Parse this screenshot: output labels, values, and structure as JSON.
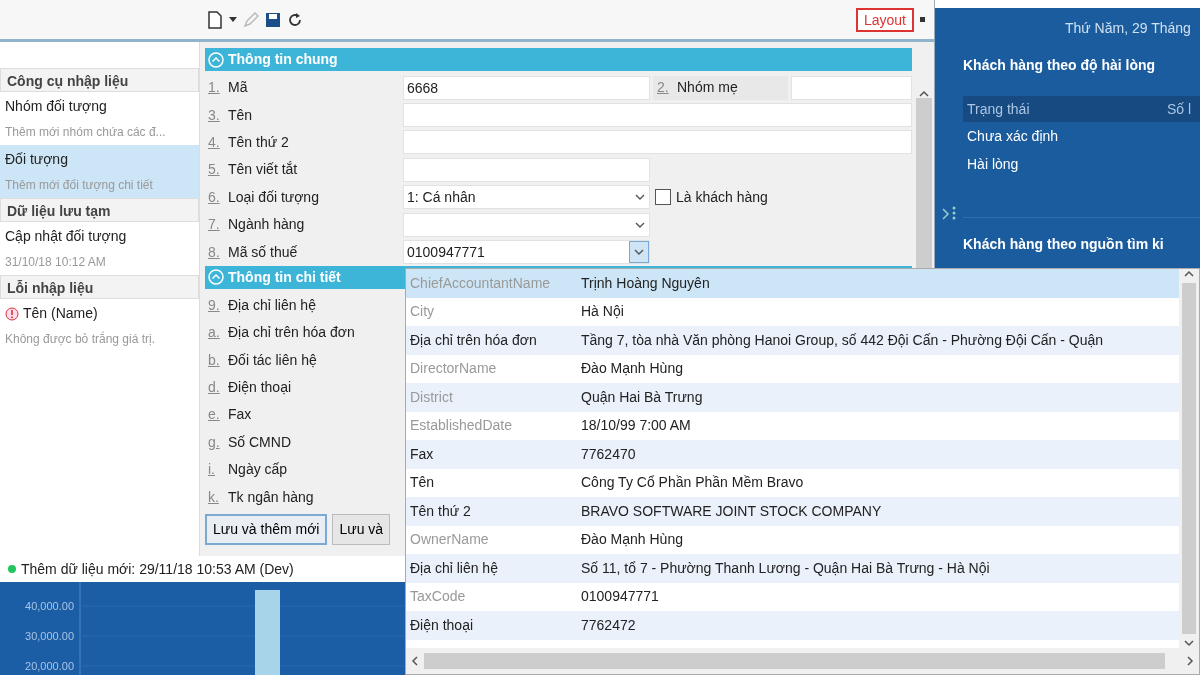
{
  "toolbar": {
    "tools": [
      {
        "kind": "new",
        "disabled": false
      },
      {
        "kind": "menu",
        "disabled": false
      },
      {
        "kind": "edit",
        "disabled": true
      },
      {
        "kind": "save",
        "disabled": false
      },
      {
        "kind": "refresh",
        "disabled": false
      }
    ],
    "layout_button": "Layout"
  },
  "sidebar": {
    "sections": [
      {
        "title": "Công cụ nhập liệu",
        "items": [
          {
            "kind": "task",
            "title": "Nhóm đối tượng",
            "subtitle": "Thêm mới nhóm chứa các đ...",
            "selected": false
          },
          {
            "kind": "task",
            "title": "Đối tượng",
            "subtitle": "Thêm mới đối tượng chi tiết",
            "selected": true
          }
        ]
      },
      {
        "title": "Dữ liệu lưu tạm",
        "items": [
          {
            "kind": "task",
            "title": "Cập nhật đối tượng",
            "subtitle": "31/10/18 10:12 AM",
            "selected": false
          }
        ]
      },
      {
        "title": "Lỗi nhập liệu",
        "items": [
          {
            "kind": "error",
            "title": "Tên (Name)",
            "subtitle": "Không được bỏ trắng giá trị.",
            "selected": false
          }
        ]
      }
    ]
  },
  "form": {
    "sections": [
      {
        "title": "Thông tin chung",
        "expanded": true,
        "fields": [
          {
            "hotkey": "1.",
            "label": "Mã",
            "kind": "pair",
            "value": "6668",
            "extra": {
              "hotkey": "2.",
              "label": "Nhóm mẹ"
            }
          },
          {
            "hotkey": "3.",
            "label": "Tên",
            "kind": "text"
          },
          {
            "hotkey": "4.",
            "label": "Tên thứ 2",
            "kind": "text"
          },
          {
            "hotkey": "5.",
            "label": "Tên viết tắt",
            "kind": "short_text"
          },
          {
            "hotkey": "6.",
            "label": "Loại đối tượng",
            "kind": "select",
            "value": "1: Cá nhân",
            "checkbox": {
              "label": "Là khách hàng",
              "checked": false
            }
          },
          {
            "hotkey": "7.",
            "label": "Ngành hàng",
            "kind": "select"
          },
          {
            "hotkey": "8.",
            "label": "Mã số thuế",
            "kind": "lookup",
            "value": "0100947771"
          }
        ]
      },
      {
        "title": "Thông tin chi tiết",
        "expanded": true,
        "fields": [
          {
            "hotkey": "9.",
            "label": "Địa chỉ liên hệ",
            "kind": "covered"
          },
          {
            "hotkey": "a.",
            "label": "Địa chỉ trên hóa đơn",
            "kind": "covered"
          },
          {
            "hotkey": "b.",
            "label": "Đối tác liên hệ",
            "kind": "covered"
          },
          {
            "hotkey": "d.",
            "label": "Điện thoại",
            "kind": "covered"
          },
          {
            "hotkey": "e.",
            "label": "Fax",
            "kind": "covered"
          },
          {
            "hotkey": "g.",
            "label": "Số CMND",
            "kind": "covered"
          },
          {
            "hotkey": "i.",
            "label": "Ngày cấp",
            "kind": "covered"
          },
          {
            "hotkey": "k.",
            "label": "Tk ngân hàng",
            "kind": "covered"
          }
        ]
      }
    ],
    "buttons": [
      {
        "label": "Lưu và thêm mới",
        "focused": true
      },
      {
        "label": "Lưu và",
        "focused": false
      }
    ]
  },
  "status_bar": {
    "text": "Thêm dữ liệu mới: 29/11/18 10:53 AM (Dev)",
    "color": "#22c55e"
  },
  "lookup_popup": {
    "rows": [
      {
        "field": "ChiefAccountantName",
        "value": "Trịnh Hoàng Nguyên",
        "muted": true,
        "selected": true
      },
      {
        "field": "City",
        "value": "Hà Nội",
        "muted": true,
        "selected": false
      },
      {
        "field": "Địa chỉ trên hóa đơn",
        "value": "Tầng 7, tòa nhà Văn phòng Hanoi Group, số 442 Đội Cấn - Phường Đội Cấn - Quận",
        "muted": false,
        "selected": false
      },
      {
        "field": "DirectorName",
        "value": "Đào Mạnh Hùng",
        "muted": true,
        "selected": false
      },
      {
        "field": "District",
        "value": "Quận Hai Bà Trưng",
        "muted": true,
        "selected": false
      },
      {
        "field": "EstablishedDate",
        "value": "18/10/99 7:00 AM",
        "muted": true,
        "selected": false
      },
      {
        "field": "Fax",
        "value": "7762470",
        "muted": false,
        "selected": false
      },
      {
        "field": "Tên",
        "value": "Công Ty Cổ Phần Phần Mềm Bravo",
        "muted": false,
        "selected": false
      },
      {
        "field": "Tên thứ 2",
        "value": "BRAVO SOFTWARE JOINT STOCK COMPANY",
        "muted": false,
        "selected": false
      },
      {
        "field": "OwnerName",
        "value": "Đào Mạnh Hùng",
        "muted": true,
        "selected": false
      },
      {
        "field": "Địa chỉ liên hệ",
        "value": "Số 11, tổ 7 - Phường Thanh Lương - Quận Hai Bà Trưng - Hà Nội",
        "muted": false,
        "selected": false
      },
      {
        "field": "TaxCode",
        "value": "0100947771",
        "muted": true,
        "selected": false
      },
      {
        "field": "Điện thoại",
        "value": "7762472",
        "muted": false,
        "selected": false
      }
    ]
  },
  "dashboard": {
    "date": "Thứ Năm, 29 Tháng",
    "panels": [
      {
        "title": "Khách hàng theo độ hài lòng",
        "columns": [
          "Trạng thái",
          "Số l"
        ],
        "rows": [
          "Chưa xác định",
          "Hài lòng"
        ]
      },
      {
        "title": "Khách hàng theo nguồn tìm ki"
      }
    ],
    "chart": {
      "y_labels": [
        "40,000.00",
        "30,000.00",
        "20,000.00"
      ]
    }
  }
}
